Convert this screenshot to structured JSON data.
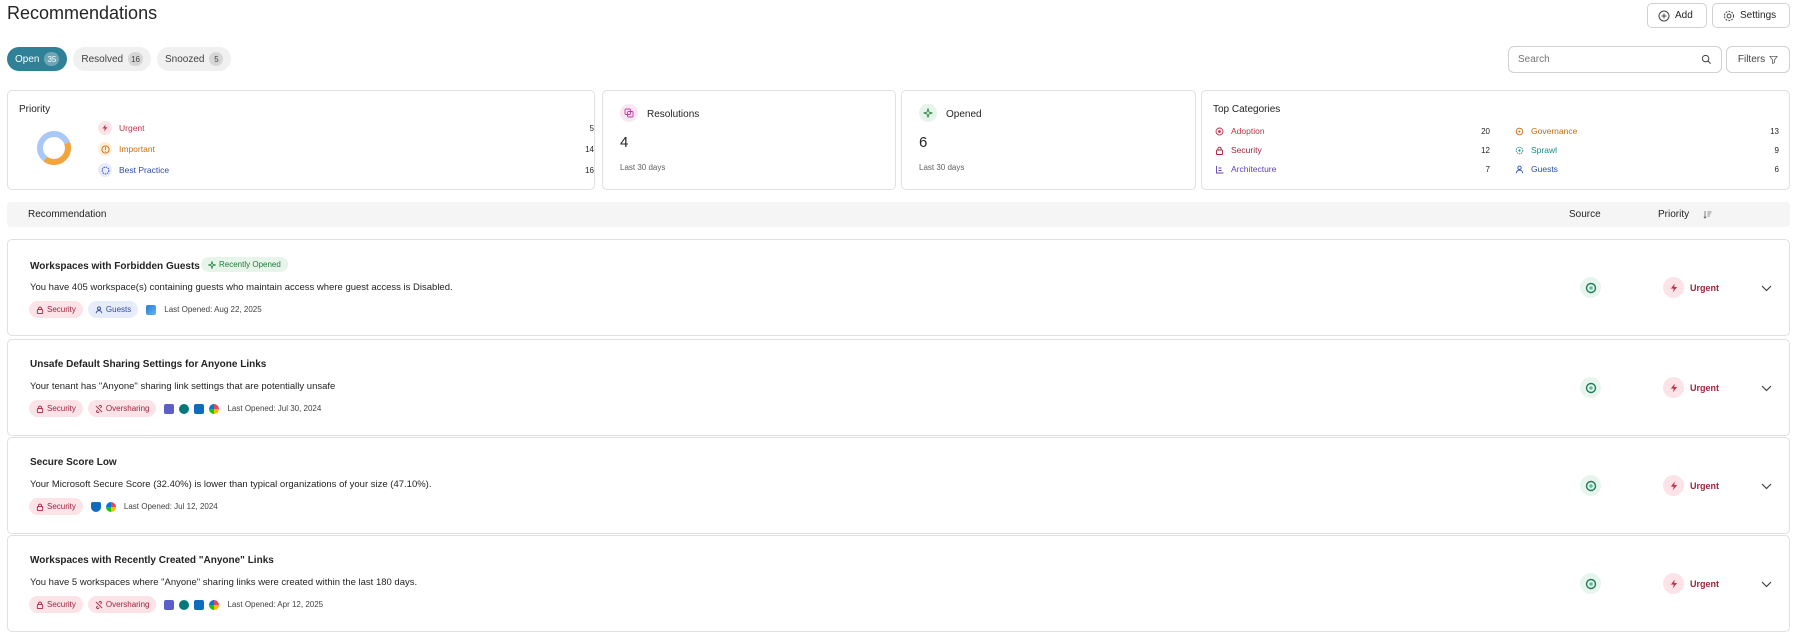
{
  "header": {
    "title": "Recommendations",
    "add_label": "Add",
    "settings_label": "Settings"
  },
  "tabs": [
    {
      "label": "Open",
      "count": "35"
    },
    {
      "label": "Resolved",
      "count": "16"
    },
    {
      "label": "Snoozed",
      "count": "5"
    }
  ],
  "search": {
    "placeholder": "Search"
  },
  "filters_label": "Filters",
  "priority_card": {
    "title": "Priority",
    "items": [
      {
        "label": "Urgent",
        "count": "5",
        "color": "#c4314b"
      },
      {
        "label": "Important",
        "count": "14",
        "color": "#c86a0a"
      },
      {
        "label": "Best Practice",
        "count": "16",
        "color": "#2d4ba8"
      }
    ],
    "donut_colors": [
      "#f3a53a",
      "#a9c8f5"
    ]
  },
  "resolutions_card": {
    "label": "Resolutions",
    "value": "4",
    "sub": "Last 30 days"
  },
  "opened_card": {
    "label": "Opened",
    "value": "6",
    "sub": "Last 30 days"
  },
  "categories_card": {
    "title": "Top Categories",
    "left": [
      {
        "label": "Adoption",
        "count": "20",
        "color": "#c4314b"
      },
      {
        "label": "Security",
        "count": "12",
        "color": "#a0243c"
      },
      {
        "label": "Architecture",
        "count": "7",
        "color": "#5b3fb8"
      }
    ],
    "right": [
      {
        "label": "Governance",
        "count": "13",
        "color": "#c86a0a"
      },
      {
        "label": "Sprawl",
        "count": "9",
        "color": "#1a8a8a"
      },
      {
        "label": "Guests",
        "count": "6",
        "color": "#2d4ba8"
      }
    ]
  },
  "table": {
    "col_recommendation": "Recommendation",
    "col_source": "Source",
    "col_priority": "Priority"
  },
  "recommendations": [
    {
      "title": "Workspaces with Forbidden Guests",
      "badge": "Recently Opened",
      "description": "You have 405 workspace(s) containing guests who maintain access where guest access is Disabled.",
      "tags": [
        "Security",
        "Guests"
      ],
      "last_opened": "Last Opened: Aug 22, 2025",
      "priority": "Urgent"
    },
    {
      "title": "Unsafe Default Sharing Settings for Anyone Links",
      "description": "Your tenant has \"Anyone\" sharing link settings that are potentially unsafe",
      "tags": [
        "Security",
        "Oversharing"
      ],
      "last_opened": "Last Opened: Jul 30, 2024",
      "priority": "Urgent"
    },
    {
      "title": "Secure Score Low",
      "description": "Your Microsoft Secure Score (32.40%) is lower than typical organizations of your size (47.10%).",
      "tags": [
        "Security"
      ],
      "last_opened": "Last Opened: Jul 12, 2024",
      "priority": "Urgent"
    },
    {
      "title": "Workspaces with Recently Created \"Anyone\" Links",
      "description": "You have 5 workspaces where \"Anyone\" sharing links were created within the last 180 days.",
      "tags": [
        "Security",
        "Oversharing"
      ],
      "last_opened": "Last Opened: Apr 12, 2025",
      "priority": "Urgent"
    }
  ]
}
